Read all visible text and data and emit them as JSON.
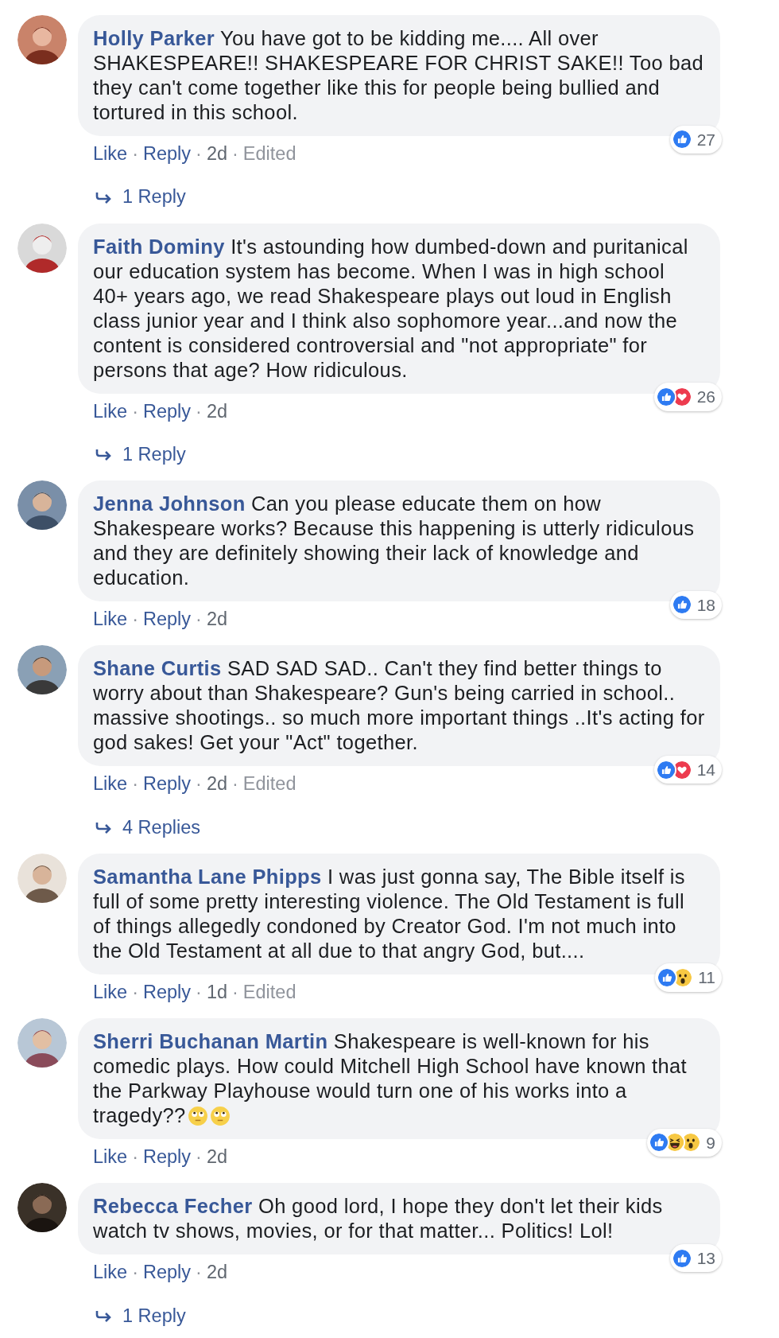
{
  "comments": [
    {
      "author": "Holly Parker",
      "text": "You have got to be kidding me.... All over SHAKESPEARE!! SHAKESPEARE FOR CHRIST SAKE!! Too bad they can't come together like this for people being bullied and tortured in this school.",
      "reactions": [
        {
          "kind": "like"
        }
      ],
      "reaction_count": "27",
      "meta": [
        {
          "kind": "link",
          "text": "Like"
        },
        {
          "kind": "dot",
          "text": "·"
        },
        {
          "kind": "link",
          "text": "Reply"
        },
        {
          "kind": "dot",
          "text": "·"
        },
        {
          "kind": "time",
          "text": "2d"
        },
        {
          "kind": "dot",
          "text": "·"
        },
        {
          "kind": "note",
          "text": "Edited"
        }
      ],
      "replies": "1 Reply"
    },
    {
      "author": "Faith Dominy",
      "text": "It's astounding how dumbed-down and puritanical our education system has become. When I was in high school 40+ years ago, we read Shakespeare plays out loud in English class junior year and I think also sophomore year...and now the content is considered controversial and \"not appropriate\" for persons that age? How ridiculous.",
      "reactions": [
        {
          "kind": "like"
        },
        {
          "kind": "love"
        }
      ],
      "reaction_count": "26",
      "meta": [
        {
          "kind": "link",
          "text": "Like"
        },
        {
          "kind": "dot",
          "text": "·"
        },
        {
          "kind": "link",
          "text": "Reply"
        },
        {
          "kind": "dot",
          "text": "·"
        },
        {
          "kind": "time",
          "text": "2d"
        }
      ],
      "replies": "1 Reply"
    },
    {
      "author": "Jenna Johnson",
      "text": "Can you please educate them on how Shakespeare works? Because this happening is utterly ridiculous and they are definitely showing their lack of knowledge and education.",
      "reactions": [
        {
          "kind": "like"
        }
      ],
      "reaction_count": "18",
      "meta": [
        {
          "kind": "link",
          "text": "Like"
        },
        {
          "kind": "dot",
          "text": "·"
        },
        {
          "kind": "link",
          "text": "Reply"
        },
        {
          "kind": "dot",
          "text": "·"
        },
        {
          "kind": "time",
          "text": "2d"
        }
      ]
    },
    {
      "author": "Shane Curtis",
      "text": "SAD SAD SAD.. Can't they find better things to worry about than Shakespeare? Gun's being carried in school.. massive shootings.. so much more important things ..It's acting for god sakes! Get your \"Act\" together.",
      "reactions": [
        {
          "kind": "like"
        },
        {
          "kind": "love"
        }
      ],
      "reaction_count": "14",
      "meta": [
        {
          "kind": "link",
          "text": "Like"
        },
        {
          "kind": "dot",
          "text": "·"
        },
        {
          "kind": "link",
          "text": "Reply"
        },
        {
          "kind": "dot",
          "text": "·"
        },
        {
          "kind": "time",
          "text": "2d"
        },
        {
          "kind": "dot",
          "text": "·"
        },
        {
          "kind": "note",
          "text": "Edited"
        }
      ],
      "replies": "4 Replies"
    },
    {
      "author": "Samantha Lane Phipps",
      "text": "I was just gonna say, The Bible itself is full of some pretty interesting violence. The Old Testament is full of things allegedly condoned by Creator God. I'm not much into the Old Testament at all due to that angry God, but....",
      "reactions": [
        {
          "kind": "like"
        },
        {
          "kind": "wow"
        }
      ],
      "reaction_count": "11",
      "meta": [
        {
          "kind": "link",
          "text": "Like"
        },
        {
          "kind": "dot",
          "text": "·"
        },
        {
          "kind": "link",
          "text": "Reply"
        },
        {
          "kind": "dot",
          "text": "·"
        },
        {
          "kind": "time",
          "text": "1d"
        },
        {
          "kind": "dot",
          "text": "·"
        },
        {
          "kind": "note",
          "text": "Edited"
        }
      ]
    },
    {
      "author": "Sherri Buchanan Martin",
      "text": "Shakespeare is well-known for his comedic plays. How could Mitchell High School have known that the Parkway Playhouse would turn one of his works into a tragedy??",
      "emojis": [
        {
          "kind": "eye-roll"
        },
        {
          "kind": "eye-roll"
        }
      ],
      "reactions": [
        {
          "kind": "like"
        },
        {
          "kind": "haha"
        },
        {
          "kind": "wow"
        }
      ],
      "reaction_count": "9",
      "meta": [
        {
          "kind": "link",
          "text": "Like"
        },
        {
          "kind": "dot",
          "text": "·"
        },
        {
          "kind": "link",
          "text": "Reply"
        },
        {
          "kind": "dot",
          "text": "·"
        },
        {
          "kind": "time",
          "text": "2d"
        }
      ]
    },
    {
      "author": "Rebecca Fecher",
      "text": "Oh good lord, I hope they don't let their kids watch tv shows, movies, or for that matter... Politics! Lol!",
      "reactions": [
        {
          "kind": "like"
        }
      ],
      "reaction_count": "13",
      "meta": [
        {
          "kind": "link",
          "text": "Like"
        },
        {
          "kind": "dot",
          "text": "·"
        },
        {
          "kind": "link",
          "text": "Reply"
        },
        {
          "kind": "dot",
          "text": "·"
        },
        {
          "kind": "time",
          "text": "2d"
        }
      ],
      "replies": "1 Reply"
    }
  ]
}
